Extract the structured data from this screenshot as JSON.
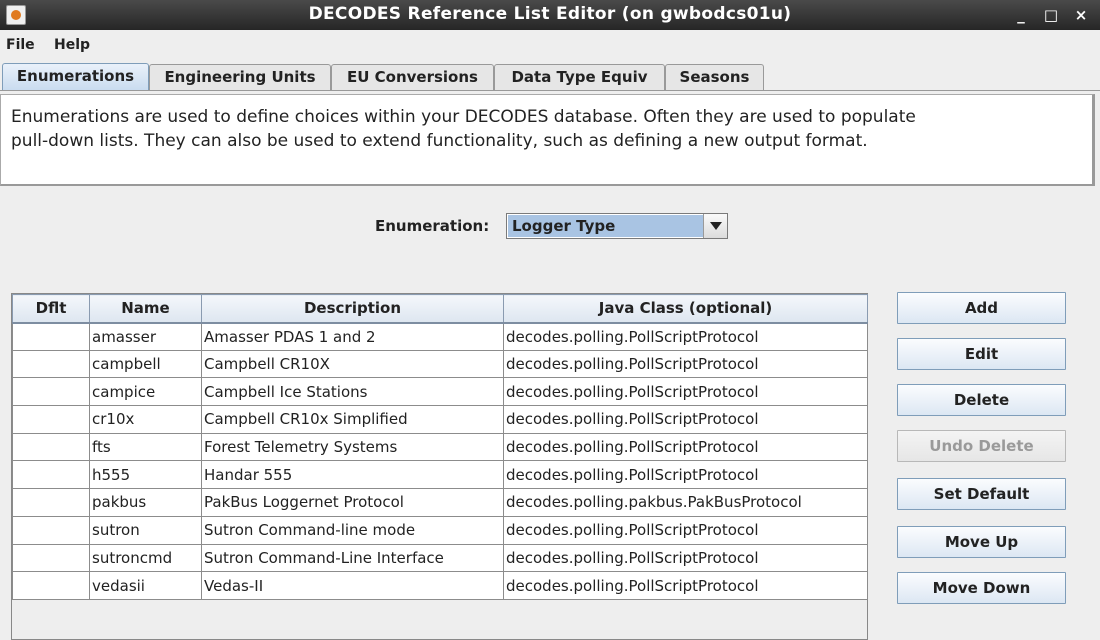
{
  "window": {
    "title": "DECODES Reference List Editor (on gwbodcs01u)",
    "controls": {
      "minimize": "_",
      "maximize": "□",
      "close": "×"
    }
  },
  "menu": [
    "File",
    "Help"
  ],
  "tabs": [
    {
      "label": "Enumerations",
      "active": true
    },
    {
      "label": "Engineering Units",
      "active": false
    },
    {
      "label": "EU Conversions",
      "active": false
    },
    {
      "label": "Data Type Equiv",
      "active": false
    },
    {
      "label": "Seasons",
      "active": false
    }
  ],
  "description": {
    "line1": "Enumerations are used to define choices within your DECODES database. Often they are used to populate",
    "line2": "pull-down lists. They can also be used to extend functionality, such as defining a new output format."
  },
  "enumeration": {
    "label": "Enumeration:",
    "selected": "Logger Type"
  },
  "table": {
    "columns": [
      "Dflt",
      "Name",
      "Description",
      "Java Class (optional)"
    ],
    "rows": [
      [
        "",
        "amasser",
        "Amasser PDAS 1 and 2",
        "decodes.polling.PollScriptProtocol"
      ],
      [
        "",
        "campbell",
        "Campbell CR10X",
        "decodes.polling.PollScriptProtocol"
      ],
      [
        "",
        "campice",
        "Campbell Ice Stations",
        "decodes.polling.PollScriptProtocol"
      ],
      [
        "",
        "cr10x",
        "Campbell CR10x Simplified",
        "decodes.polling.PollScriptProtocol"
      ],
      [
        "",
        "fts",
        "Forest Telemetry Systems",
        "decodes.polling.PollScriptProtocol"
      ],
      [
        "",
        "h555",
        "Handar 555",
        "decodes.polling.PollScriptProtocol"
      ],
      [
        "",
        "pakbus",
        "PakBus Loggernet Protocol",
        "decodes.polling.pakbus.PakBusProtocol"
      ],
      [
        "",
        "sutron",
        "Sutron Command-line mode",
        "decodes.polling.PollScriptProtocol"
      ],
      [
        "",
        "sutroncmd",
        "Sutron Command-Line Interface",
        "decodes.polling.PollScriptProtocol"
      ],
      [
        "",
        "vedasii",
        "Vedas-II",
        "decodes.polling.PollScriptProtocol"
      ]
    ]
  },
  "buttons": {
    "add": "Add",
    "edit": "Edit",
    "delete": "Delete",
    "undo_delete": "Undo Delete",
    "set_default": "Set Default",
    "move_up": "Move Up",
    "move_down": "Move Down"
  },
  "icons": {
    "app": "java-app-icon",
    "dropdown": "chevron-down-icon"
  }
}
